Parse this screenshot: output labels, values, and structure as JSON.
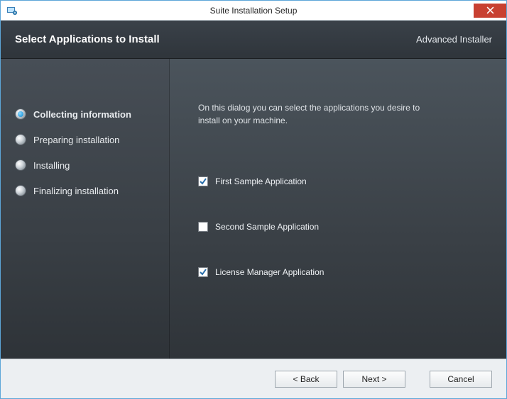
{
  "window": {
    "title": "Suite Installation Setup"
  },
  "header": {
    "title": "Select Applications to Install",
    "brand": "Advanced Installer"
  },
  "steps": [
    {
      "label": "Collecting information",
      "active": true
    },
    {
      "label": "Preparing installation",
      "active": false
    },
    {
      "label": "Installing",
      "active": false
    },
    {
      "label": "Finalizing installation",
      "active": false
    }
  ],
  "main": {
    "description": "On this dialog you can select the applications you desire to install on your machine."
  },
  "apps": [
    {
      "label": "First Sample Application",
      "checked": true
    },
    {
      "label": "Second Sample Application",
      "checked": false
    },
    {
      "label": "License Manager Application",
      "checked": true
    }
  ],
  "footer": {
    "back": "< Back",
    "next": "Next >",
    "cancel": "Cancel"
  }
}
